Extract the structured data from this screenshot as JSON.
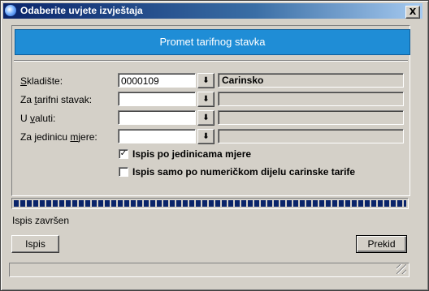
{
  "window": {
    "title": "Odaberite uvjete izvještaja",
    "close_label": "X"
  },
  "banner": {
    "title": "Promet tarifnog stavka"
  },
  "form": {
    "rows": [
      {
        "label_pre": "",
        "label_u": "S",
        "label_post": "kladište:",
        "value": "0000109",
        "lookup": "⬇",
        "description": "Carinsko"
      },
      {
        "label_pre": "Za ",
        "label_u": "t",
        "label_post": "arifni stavak:",
        "value": "",
        "lookup": "⬇",
        "description": ""
      },
      {
        "label_pre": "U ",
        "label_u": "v",
        "label_post": "aluti:",
        "value": "",
        "lookup": "⬇",
        "description": ""
      },
      {
        "label_pre": "Za jedinicu ",
        "label_u": "m",
        "label_post": "jere:",
        "value": "",
        "lookup": "⬇",
        "description": ""
      }
    ],
    "checkboxes": [
      {
        "label": "Ispis po jedinicama mjere",
        "checked": true,
        "mark": "✓"
      },
      {
        "label": "Ispis samo po numeričkom dijelu carinske tarife",
        "checked": false,
        "mark": ""
      }
    ]
  },
  "progress": {
    "value": 1.0
  },
  "status": {
    "text": "Ispis završen"
  },
  "buttons": {
    "print": "Ispis",
    "cancel": "Prekid"
  },
  "colors": {
    "banner": "#1f8dd6",
    "progress": "#0a246a",
    "titlebar": "#0a246a",
    "face": "#d4d0c8"
  }
}
